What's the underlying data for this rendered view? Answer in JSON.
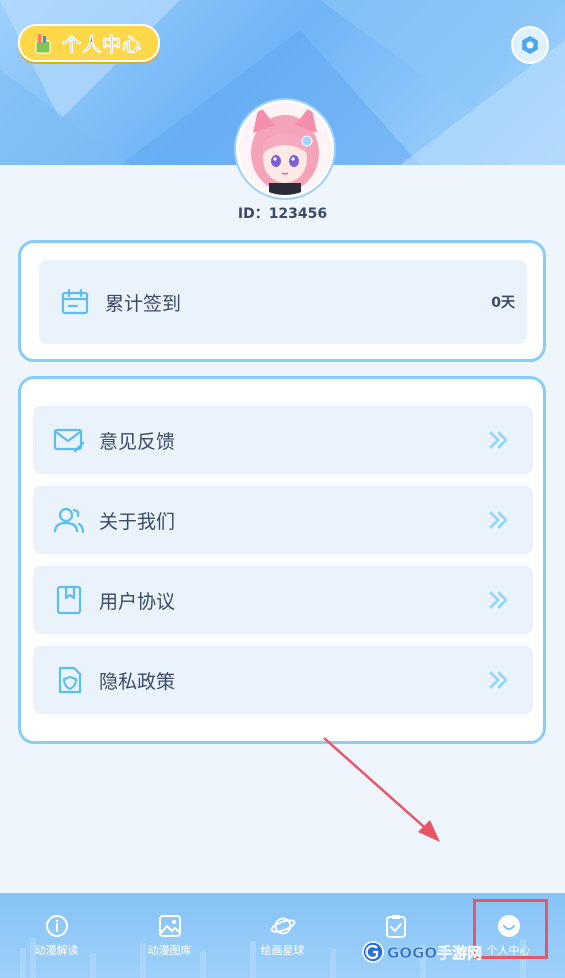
{
  "header": {
    "title": "个人中心",
    "settings_icon": "settings-icon"
  },
  "profile": {
    "id_label": "ID：123456"
  },
  "checkin": {
    "label": "累计签到",
    "value": "0天",
    "icon": "calendar-icon"
  },
  "menu": {
    "items": [
      {
        "label": "意见反馈",
        "icon": "mail-icon"
      },
      {
        "label": "关于我们",
        "icon": "users-icon"
      },
      {
        "label": "用户协议",
        "icon": "bookmark-icon"
      },
      {
        "label": "隐私政策",
        "icon": "shield-icon"
      }
    ]
  },
  "tabbar": {
    "items": [
      {
        "label": "动漫解读",
        "icon": "info-icon"
      },
      {
        "label": "动漫图库",
        "icon": "image-icon"
      },
      {
        "label": "绘画星球",
        "icon": "planet-icon"
      },
      {
        "label": "",
        "icon": "clipboard-check-icon"
      },
      {
        "label": "个人中心",
        "icon": "smile-icon"
      }
    ],
    "active_index": 4
  },
  "watermark": {
    "text": "GOGO手游网"
  },
  "colors": {
    "accent": "#87cdf5",
    "title_pill": "#ffd84a",
    "highlight_box": "#e85566",
    "arrow": "#e85566"
  }
}
